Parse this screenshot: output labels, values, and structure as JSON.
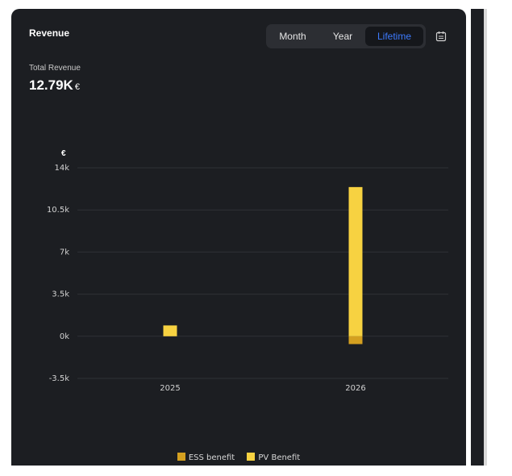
{
  "card": {
    "title": "Revenue",
    "total_label": "Total Revenue",
    "total_value": "12.79K",
    "total_unit": "€"
  },
  "period_tabs": [
    {
      "label": "Month",
      "selected": false
    },
    {
      "label": "Year",
      "selected": false
    },
    {
      "label": "Lifetime",
      "selected": true
    }
  ],
  "icons": {
    "calendar": "calendar-icon"
  },
  "colors": {
    "card_bg": "#1c1e22",
    "ess": "#d4a020",
    "pv": "#f7d241",
    "accent": "#3d7bff",
    "grid": "#2e3136"
  },
  "chart_data": {
    "type": "bar",
    "stacked": true,
    "y_unit": "€",
    "categories": [
      "2025",
      "2026"
    ],
    "series": [
      {
        "name": "ESS benefit",
        "values": [
          0,
          -650
        ]
      },
      {
        "name": "PV Benefit",
        "values": [
          900,
          12400
        ]
      }
    ],
    "yticks": [
      -3500,
      0,
      3500,
      7000,
      10500,
      14000
    ],
    "ytick_labels": [
      "-3.5k",
      "0k",
      "3.5k",
      "7k",
      "10.5k",
      "14k"
    ],
    "ylim": [
      -3500,
      14000
    ],
    "grid": true,
    "legend_position": "bottom"
  }
}
